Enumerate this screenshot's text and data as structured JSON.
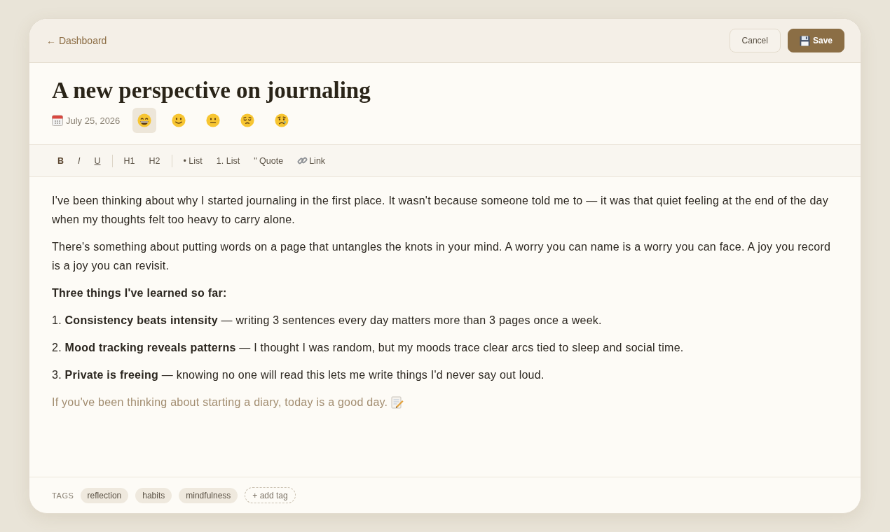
{
  "header": {
    "back_link": "← Dashboard",
    "buttons": [
      {
        "label": "Cancel",
        "kind": "secondary"
      },
      {
        "label": "Save",
        "kind": "primary"
      }
    ]
  },
  "entry": {
    "title": "A new perspective on journaling",
    "date": "July 25, 2026",
    "moods": [
      {
        "kind": "grinning",
        "selected": true
      },
      {
        "kind": "smiling",
        "selected": false
      },
      {
        "kind": "neutral",
        "selected": false
      },
      {
        "kind": "pensive",
        "selected": false
      },
      {
        "kind": "crying",
        "selected": false
      }
    ]
  },
  "toolbar": {
    "groups": [
      [
        {
          "label": "B",
          "kind": "bold"
        },
        {
          "label": "I",
          "kind": "italic"
        },
        {
          "label": "U",
          "kind": "underline"
        }
      ],
      [
        {
          "label": "H1",
          "kind": "heading"
        },
        {
          "label": "H2",
          "kind": "heading"
        }
      ],
      [
        {
          "label": "• List",
          "kind": "list"
        },
        {
          "label": "1. List",
          "kind": "list"
        },
        {
          "label": "\" Quote",
          "kind": "quote"
        },
        {
          "label": "Link",
          "kind": "link"
        }
      ]
    ]
  },
  "content": [
    {
      "kind": "paragraph",
      "text": "I've been thinking about why I started journaling in the first place. It wasn't because someone told me to — it was that quiet feeling at the end of the day when my thoughts felt too heavy to carry alone."
    },
    {
      "kind": "paragraph",
      "text": "There's something about putting words on a page that untangles the knots in your mind. A worry you can name is a worry you can face. A joy you record is a joy you can revisit."
    },
    {
      "kind": "heading",
      "text": "Three things I've learned so far:"
    },
    {
      "kind": "list_item",
      "text": "1. **Consistency beats intensity** — writing 3 sentences every day matters more than 3 pages once a week."
    },
    {
      "kind": "list_item",
      "text": "2. **Mood tracking reveals patterns** — I thought I was random, but my moods trace clear arcs tied to sleep and social time."
    },
    {
      "kind": "list_item",
      "text": "3. **Private is freeing** — knowing no one will read this lets me write things I'd never say out loud."
    },
    {
      "kind": "closing",
      "text": "If you've been thinking about starting a diary, today is a good day."
    }
  ],
  "footer": {
    "tags_label": "TAGS",
    "tags": [
      "reflection",
      "habits",
      "mindfulness"
    ],
    "add_tag": "+ add tag"
  }
}
